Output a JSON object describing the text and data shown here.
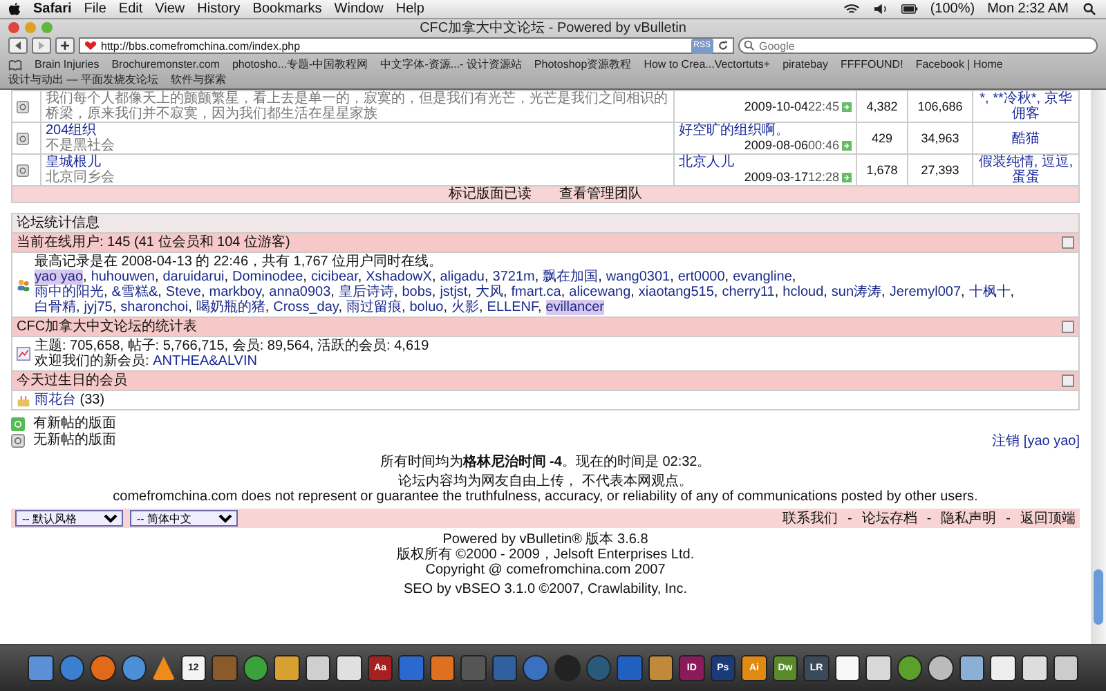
{
  "menubar": {
    "app": "Safari",
    "menus": [
      "File",
      "Edit",
      "View",
      "History",
      "Bookmarks",
      "Window",
      "Help"
    ],
    "battery": "(100%)",
    "clock": "Mon 2:32 AM"
  },
  "window": {
    "title": "CFC加拿大中文论坛 - Powered by vBulletin"
  },
  "toolbar": {
    "url": "http://bbs.comefromchina.com/index.php",
    "rss": "RSS",
    "search_placeholder": "Google"
  },
  "bookmarks": [
    "Brain Injuries",
    "Brochuremonster.com",
    "photosho...专题-中国教程网",
    "中文字体-资源...- 设计资源站",
    "Photoshop资源教程",
    "How to Crea...Vectortuts+",
    "piratebay",
    "FFFFOUND!",
    "Facebook | Home",
    "设计与动出 — 平面发烧友论坛",
    "软件与探索"
  ],
  "forums": [
    {
      "description": "我们每个人都像天上的颤颤繁星，看上去是单一的，寂寞的，但是我们有光芒，光芒是我们之间相识的桥梁，原来我们并不寂寞，因为我们都生活在星星家族",
      "date": "2009-10-04",
      "time": "22:45",
      "threads": "4,382",
      "posts": "106,686",
      "moderators": "*, **冷秋*, 京华佣客"
    },
    {
      "name": "204组织",
      "description": "不是黑社会",
      "last_poster": "好空旷的组织啊。",
      "date": "2009-08-06",
      "time": "00:46",
      "threads": "429",
      "posts": "34,963",
      "moderators": "酷猫"
    },
    {
      "name": "皇城根儿",
      "description": "北京同乡会",
      "last_poster": "北京人儿",
      "date": "2009-03-17",
      "time": "12:28",
      "threads": "1,678",
      "posts": "27,393",
      "moderators": "假装纯情, 逗逗, 蛋蛋"
    }
  ],
  "forum_footer": [
    "标记版面已读",
    "查看管理团队"
  ],
  "stats": {
    "title": "论坛统计信息",
    "online_header": "当前在线用户: 145 (41 位会员和 104 位游客)",
    "record": "最高记录是在 2008-04-13 的 22:46，共有 1,767 位用户同时在线。",
    "users": [
      {
        "name": "yao yao",
        "highlighted": true
      },
      {
        "name": "huhouwen",
        "highlighted": false
      },
      {
        "name": "daruidarui",
        "highlighted": false
      },
      {
        "name": "Dominodee",
        "highlighted": false
      },
      {
        "name": "cicibear",
        "highlighted": false
      },
      {
        "name": "XshadowX",
        "highlighted": false
      },
      {
        "name": "aligadu",
        "highlighted": false
      },
      {
        "name": "3721m",
        "highlighted": false
      },
      {
        "name": "飘在加国",
        "highlighted": false
      },
      {
        "name": "wang0301",
        "highlighted": false
      },
      {
        "name": "ert0000",
        "highlighted": false
      },
      {
        "name": "evangline",
        "highlighted": false
      },
      {
        "name": "雨中的阳光",
        "highlighted": false
      },
      {
        "name": "&雪糕&",
        "highlighted": false
      },
      {
        "name": "Steve",
        "highlighted": false
      },
      {
        "name": "markboy",
        "highlighted": false
      },
      {
        "name": "anna0903",
        "highlighted": false
      },
      {
        "name": "皇后诗诗",
        "highlighted": false
      },
      {
        "name": "bobs",
        "highlighted": false
      },
      {
        "name": "jstjst",
        "highlighted": false
      },
      {
        "name": "大风",
        "highlighted": false
      },
      {
        "name": "fmart.ca",
        "highlighted": false
      },
      {
        "name": "alicewang",
        "highlighted": false
      },
      {
        "name": "xiaotang515",
        "highlighted": false
      },
      {
        "name": "cherry11",
        "highlighted": false
      },
      {
        "name": "hcloud",
        "highlighted": false
      },
      {
        "name": "sun涛涛",
        "highlighted": false
      },
      {
        "name": "Jeremyl007",
        "highlighted": false
      },
      {
        "name": "十枫十",
        "highlighted": false
      },
      {
        "name": "白骨精",
        "highlighted": false
      },
      {
        "name": "jyj75",
        "highlighted": false
      },
      {
        "name": "sharonchoi",
        "highlighted": false
      },
      {
        "name": "喝奶瓶的猪",
        "highlighted": false
      },
      {
        "name": "Cross_day",
        "highlighted": false
      },
      {
        "name": "雨过留痕",
        "highlighted": false
      },
      {
        "name": "boluo",
        "highlighted": false
      },
      {
        "name": "火影",
        "highlighted": false
      },
      {
        "name": "ELLENF",
        "highlighted": false
      },
      {
        "name": "evillancer",
        "highlighted": true
      }
    ],
    "user_separator": ",",
    "totals_header": "CFC加拿大中文论坛的统计表",
    "totals": "主题: 705,658, 帖子: 5,766,715, 会员: 89,564, 活跃的会员: 4,619",
    "welcome": "欢迎我们的新会员:",
    "newest_member": "ANTHEA&ALVIN",
    "birthday_header": "今天过生日的会员",
    "birthday_member": "雨花台",
    "birthday_age": "(33)"
  },
  "legend": [
    "有新帖的版面",
    "无新帖的版面"
  ],
  "logout": {
    "label": "注销",
    "user": "[yao yao]"
  },
  "timezone": "所有时间均为**格林尼治时间 -4**。现在的时间是 02:32。",
  "disclaimer": [
    "论坛内容均为网友自由上传， 不代表本网观点。",
    "comefromchina.com does not represent or guarantee the truthfulness, accuracy, or reliability of any of communications posted by other users."
  ],
  "footer_selects": [
    "-- 默认风格",
    "-- 简体中文"
  ],
  "footer_links": [
    "联系我们",
    "论坛存档",
    "隐私声明",
    "返回顶端"
  ],
  "link_separator": "-",
  "credits": [
    "Powered by vBulletin® 版本 3.6.8",
    "版权所有 ©2000 - 2009，Jelsoft Enterprises Ltd.",
    "Copyright @ comefromchina.com 2007"
  ],
  "seo": "SEO by vBSEO 3.1.0 ©2007, Crawlability, Inc.",
  "dock": [
    {
      "kind": "square",
      "color": "#5b8fd6"
    },
    {
      "kind": "round",
      "color": "#3a7fd0"
    },
    {
      "kind": "round",
      "color": "#e06a1a"
    },
    {
      "kind": "round",
      "color": "#4a8fd8"
    },
    {
      "kind": "cone",
      "color": "#f08a1a"
    },
    {
      "kind": "square",
      "color": "#f4f4f4",
      "label": "12"
    },
    {
      "kind": "square",
      "color": "#8a5a2a"
    },
    {
      "kind": "round",
      "color": "#3aa23a"
    },
    {
      "kind": "square",
      "color": "#d8a030"
    },
    {
      "kind": "square",
      "color": "#cfcfcf"
    },
    {
      "kind": "square",
      "color": "#e0e0e0"
    },
    {
      "kind": "square",
      "color": "#a52020",
      "label": "Aa"
    },
    {
      "kind": "square",
      "color": "#2a6ad0"
    },
    {
      "kind": "square",
      "color": "#e07020"
    },
    {
      "kind": "square",
      "color": "#555555"
    },
    {
      "kind": "square",
      "color": "#3060a0"
    },
    {
      "kind": "round",
      "color": "#3a70c0"
    },
    {
      "kind": "round",
      "color": "#222222"
    },
    {
      "kind": "round",
      "color": "#2a5a7a"
    },
    {
      "kind": "square",
      "color": "#2060c0"
    },
    {
      "kind": "square",
      "color": "#c08a3a"
    },
    {
      "kind": "square",
      "color": "#8a1a5a",
      "label": "ID"
    },
    {
      "kind": "square",
      "color": "#1a3a7a",
      "label": "Ps"
    },
    {
      "kind": "square",
      "color": "#e08a10",
      "label": "Ai"
    },
    {
      "kind": "square",
      "color": "#5a8a2a",
      "label": "Dw"
    },
    {
      "kind": "square",
      "color": "#3a4a5a",
      "label": "LR"
    },
    {
      "kind": "square",
      "color": "#f8f8f8"
    },
    {
      "kind": "square",
      "color": "#d8d8d8"
    },
    {
      "kind": "round",
      "color": "#5aa02a"
    },
    {
      "kind": "round",
      "color": "#bbbbbb"
    },
    {
      "kind": "square",
      "color": "#8ab0d8"
    },
    {
      "kind": "square",
      "color": "#eeeeee"
    },
    {
      "kind": "square",
      "color": "#dddddd"
    },
    {
      "kind": "square",
      "color": "#cccccc"
    }
  ]
}
